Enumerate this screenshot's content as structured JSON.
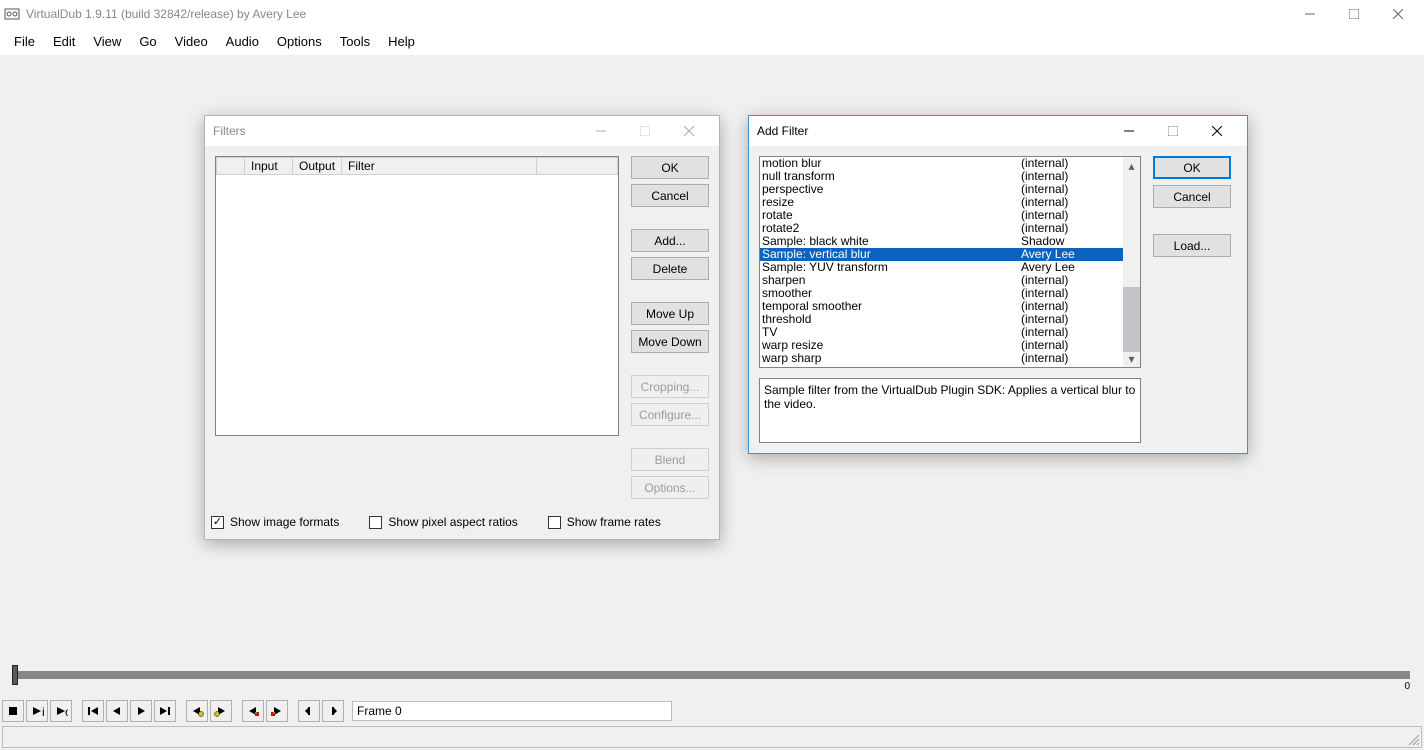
{
  "app": {
    "title": "VirtualDub 1.9.11 (build 32842/release) by Avery Lee"
  },
  "menu": [
    "File",
    "Edit",
    "View",
    "Go",
    "Video",
    "Audio",
    "Options",
    "Tools",
    "Help"
  ],
  "filters_dialog": {
    "title": "Filters",
    "columns": {
      "blank": "",
      "input": "Input",
      "output": "Output",
      "filter": "Filter"
    },
    "buttons": {
      "ok": "OK",
      "cancel": "Cancel",
      "add": "Add...",
      "delete": "Delete",
      "moveup": "Move Up",
      "movedown": "Move Down",
      "cropping": "Cropping...",
      "configure": "Configure...",
      "blend": "Blend",
      "options": "Options..."
    },
    "checkboxes": {
      "show_image_formats": "Show image formats",
      "show_pixel_aspect": "Show pixel aspect ratios",
      "show_frame_rates": "Show frame rates"
    }
  },
  "add_filter_dialog": {
    "title": "Add Filter",
    "buttons": {
      "ok": "OK",
      "cancel": "Cancel",
      "load": "Load..."
    },
    "description": "Sample filter from the VirtualDub Plugin SDK: Applies a vertical blur to the video.",
    "rows": [
      {
        "name": "motion blur",
        "auth": "(internal)"
      },
      {
        "name": "null transform",
        "auth": "(internal)"
      },
      {
        "name": "perspective",
        "auth": "(internal)"
      },
      {
        "name": "resize",
        "auth": "(internal)"
      },
      {
        "name": "rotate",
        "auth": "(internal)"
      },
      {
        "name": "rotate2",
        "auth": "(internal)"
      },
      {
        "name": "Sample: black white",
        "auth": "Shadow"
      },
      {
        "name": "Sample: vertical blur",
        "auth": "Avery Lee",
        "selected": true
      },
      {
        "name": "Sample: YUV transform",
        "auth": "Avery Lee"
      },
      {
        "name": "sharpen",
        "auth": "(internal)"
      },
      {
        "name": "smoother",
        "auth": "(internal)"
      },
      {
        "name": "temporal smoother",
        "auth": "(internal)"
      },
      {
        "name": "threshold",
        "auth": "(internal)"
      },
      {
        "name": "TV",
        "auth": "(internal)"
      },
      {
        "name": "warp resize",
        "auth": "(internal)"
      },
      {
        "name": "warp sharp",
        "auth": "(internal)"
      }
    ]
  },
  "frame_info": "Frame 0",
  "timeline_end": "0"
}
